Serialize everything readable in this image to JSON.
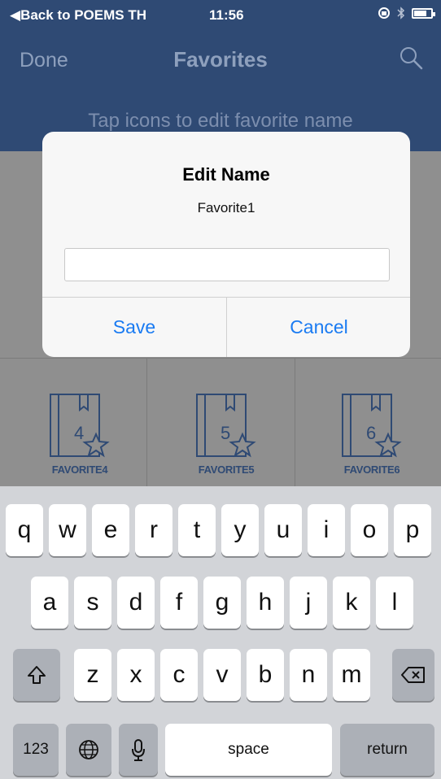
{
  "status_bar": {
    "back_label": "◀Back to POEMS TH",
    "time": "11:56"
  },
  "nav": {
    "done_label": "Done",
    "title": "Favorites",
    "search_icon": "search-icon"
  },
  "hint": "Tap icons to edit favorite name",
  "favorites": [
    {
      "number": "4",
      "label": "FAVORITE4"
    },
    {
      "number": "5",
      "label": "FAVORITE5"
    },
    {
      "number": "6",
      "label": "FAVORITE6"
    }
  ],
  "alert": {
    "title": "Edit Name",
    "message": "Favorite1",
    "input_value": "",
    "save_label": "Save",
    "cancel_label": "Cancel"
  },
  "keyboard": {
    "row1": [
      "q",
      "w",
      "e",
      "r",
      "t",
      "y",
      "u",
      "i",
      "o",
      "p"
    ],
    "row2": [
      "a",
      "s",
      "d",
      "f",
      "g",
      "h",
      "j",
      "k",
      "l"
    ],
    "row3": [
      "z",
      "x",
      "c",
      "v",
      "b",
      "n",
      "m"
    ],
    "numbers_label": "123",
    "space_label": "space",
    "return_label": "return"
  },
  "colors": {
    "nav_bg": "#2f4a74",
    "accent": "#1a7bf2",
    "keyboard_bg": "#d2d4d8"
  }
}
